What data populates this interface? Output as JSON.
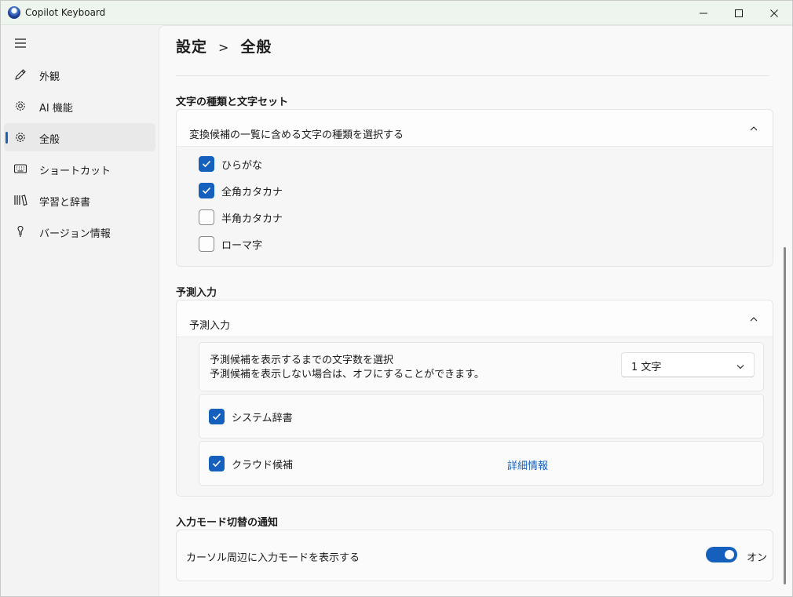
{
  "window": {
    "title": "Copilot Keyboard",
    "icons": [
      "copilot-keyboard-app-icon",
      "minimize-icon",
      "maximize-icon",
      "close-icon"
    ]
  },
  "sidebar": {
    "menu_icon": "hamburger-menu-icon",
    "items": [
      {
        "label": "外観",
        "icon": "pen-icon",
        "active": false
      },
      {
        "label": "AI 機能",
        "icon": "gear-icon",
        "active": false
      },
      {
        "label": "全般",
        "icon": "gear-icon",
        "active": true
      },
      {
        "label": "ショートカット",
        "icon": "keyboard-icon",
        "active": false
      },
      {
        "label": "学習と辞書",
        "icon": "library-icon",
        "active": false
      },
      {
        "label": "バージョン情報",
        "icon": "info-icon",
        "active": false
      }
    ]
  },
  "header": {
    "parent": "設定",
    "separator": ">",
    "current": "全般"
  },
  "char_types": {
    "section_title": "文字の種類と文字セット",
    "expander_label": "変換候補の一覧に含める文字の種類を選択する",
    "options": [
      {
        "label": "ひらがな",
        "checked": true
      },
      {
        "label": "全角カタカナ",
        "checked": true
      },
      {
        "label": "半角カタカナ",
        "checked": false
      },
      {
        "label": "ローマ字",
        "checked": false
      }
    ]
  },
  "prediction": {
    "section_title": "予測入力",
    "expander_label": "予測入力",
    "threshold_line1": "予測候補を表示するまでの文字数を選択",
    "threshold_line2": "予測候補を表示しない場合は、オフにすることができます。",
    "threshold_value": "1 文字",
    "system_dictionary_label": "システム辞書",
    "system_dictionary_checked": true,
    "cloud_label": "クラウド候補",
    "cloud_checked": true,
    "cloud_link": "詳細情報"
  },
  "mode_notify": {
    "section_title": "入力モード切替の通知",
    "label": "カーソル周辺に入力モードを表示する",
    "toggle_on": true,
    "toggle_text": "オン"
  },
  "colors": {
    "accent": "#1560bd",
    "title_bar": "#eef5ee",
    "content_bg": "#f9f9f9"
  }
}
